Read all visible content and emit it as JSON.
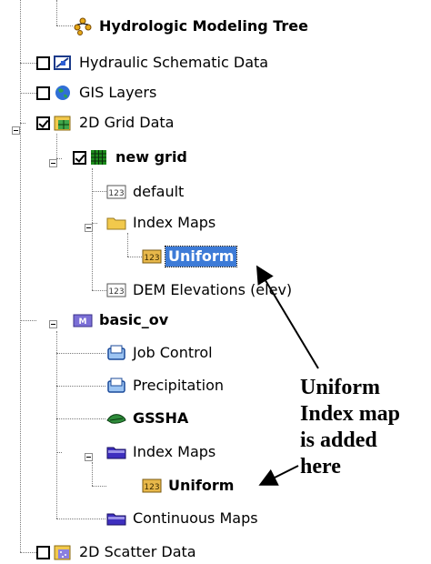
{
  "tree": {
    "hydrologic_modeling_tree": "Hydrologic Modeling Tree",
    "hydraulic_schematic_data": "Hydraulic Schematic Data",
    "gis_layers": "GIS Layers",
    "grid_data_2d": "2D Grid Data",
    "new_grid": "new grid",
    "default": "default",
    "index_maps_1": "Index Maps",
    "uniform_1": "Uniform",
    "dem_elevations": "DEM Elevations (elev)",
    "basic_ov": "basic_ov",
    "job_control": "Job Control",
    "precipitation": "Precipitation",
    "gssha": "GSSHA",
    "index_maps_2": "Index Maps",
    "uniform_2": "Uniform",
    "continuous_maps": "Continuous Maps",
    "scatter_data_2d": "2D Scatter Data"
  },
  "checkboxes": {
    "hydraulic_schematic_data": false,
    "gis_layers": false,
    "grid_data_2d": true,
    "new_grid": true,
    "scatter_data_2d": false
  },
  "callout": {
    "line1": "Uniform",
    "line2": "Index map",
    "line3": "is added",
    "line4": "here"
  },
  "colors": {
    "selection": "#3d7bd7",
    "folder": "#f2c94c",
    "map_folder": "#3e2fbf",
    "index_icon": "#e8b84a",
    "grid_icon": "#1c8a1c"
  },
  "icons": {
    "hydrologic_modeling_tree": "tree-icon",
    "hydraulic_schematic_data": "schematic-icon",
    "gis_layers": "globe-icon",
    "grid_data_2d": "grid-icon",
    "new_grid": "grid-icon",
    "default": "index-map-icon",
    "index_maps": "folder-icon",
    "dem_elevations": "index-map-icon",
    "basic_ov": "model-icon",
    "job_control": "job-control-icon",
    "precipitation": "precipitation-icon",
    "gssha": "gssha-icon",
    "continuous_maps": "map-folder-icon",
    "scatter_data_2d": "scatter-icon"
  }
}
